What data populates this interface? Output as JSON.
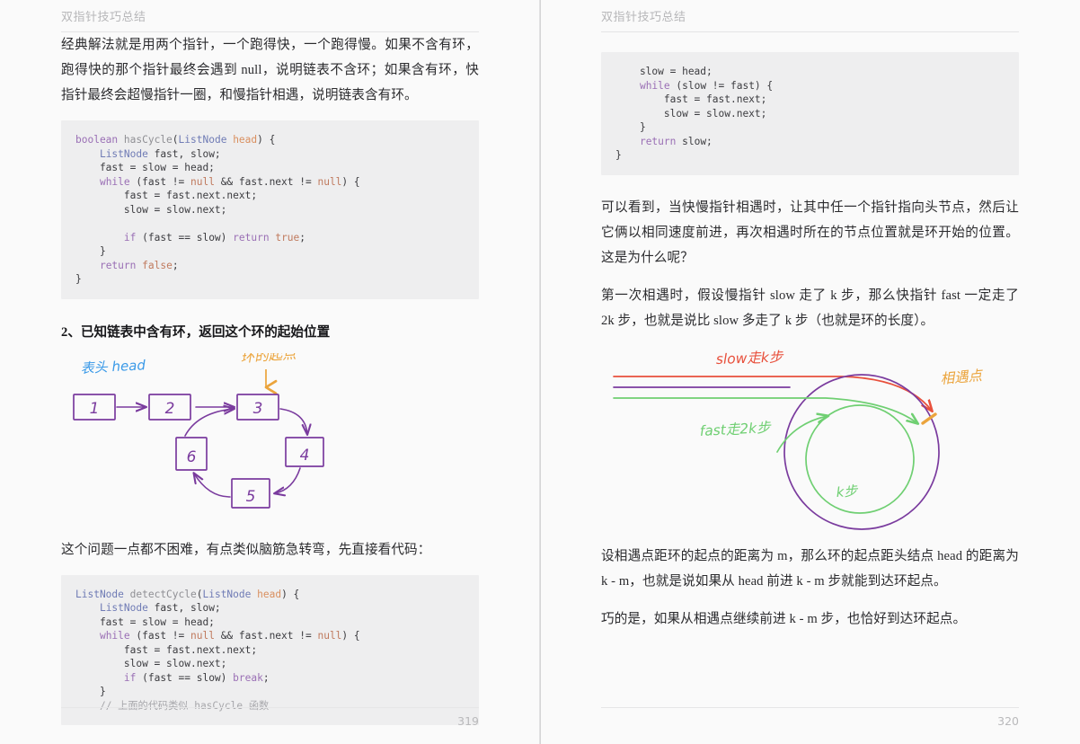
{
  "document": {
    "running_head": "双指针技巧总结",
    "colors": {
      "page_bg": "#fafafa",
      "code_bg": "#eeeeef",
      "ink_purple": "#7a3b9e",
      "ink_blue": "#3b9ae8",
      "ink_orange": "#eba43c",
      "ink_red": "#e8503c",
      "ink_green": "#6fcf72",
      "body_text": "#2b2b2e",
      "muted": "#b7b7b9"
    }
  },
  "left_page": {
    "page_number": "319",
    "paragraph_1": "经典解法就是用两个指针，一个跑得快，一个跑得慢。如果不含有环，跑得快的那个指针最终会遇到 null，说明链表不含环；如果含有环，快指针最终会超慢指针一圈，和慢指针相遇，说明链表含有环。",
    "code_1": {
      "language": "java",
      "lines": [
        "boolean hasCycle(ListNode head) {",
        "    ListNode fast, slow;",
        "    fast = slow = head;",
        "    while (fast != null && fast.next != null) {",
        "        fast = fast.next.next;",
        "        slow = slow.next;",
        "",
        "        if (fast == slow) return true;",
        "    }",
        "    return false;",
        "}"
      ]
    },
    "section_heading": "2、已知链表中含有环，返回这个环的起始位置",
    "figure": {
      "caption_head": "表头 head",
      "caption_cycle_start": "环的起点",
      "nodes": [
        "1",
        "2",
        "3",
        "4",
        "5",
        "6"
      ],
      "edges": "1→2→3→4→5→6→3"
    },
    "paragraph_2": "这个问题一点都不困难，有点类似脑筋急转弯，先直接看代码：",
    "code_2": {
      "language": "java",
      "lines": [
        "ListNode detectCycle(ListNode head) {",
        "    ListNode fast, slow;",
        "    fast = slow = head;",
        "    while (fast != null && fast.next != null) {",
        "        fast = fast.next.next;",
        "        slow = slow.next;",
        "        if (fast == slow) break;",
        "    }",
        "    // 上面的代码类似 hasCycle 函数"
      ]
    }
  },
  "right_page": {
    "page_number": "320",
    "code_1": {
      "language": "java",
      "lines": [
        "    slow = head;",
        "    while (slow != fast) {",
        "        fast = fast.next;",
        "        slow = slow.next;",
        "    }",
        "    return slow;",
        "}"
      ]
    },
    "paragraph_1": "可以看到，当快慢指针相遇时，让其中任一个指针指向头节点，然后让它俩以相同速度前进，再次相遇时所在的节点位置就是环开始的位置。这是为什么呢？",
    "paragraph_2": "第一次相遇时，假设慢指针 slow 走了 k 步，那么快指针 fast 一定走了 2k 步，也就是说比 slow 多走了 k 步（也就是环的长度）。",
    "figure": {
      "label_slow": "slow走k步",
      "label_fast": "fast走2k步",
      "label_meeting": "相遇点",
      "label_k": "k步"
    },
    "paragraph_3": "设相遇点距环的起点的距离为 m，那么环的起点距头结点 head 的距离为 k - m，也就是说如果从 head 前进 k - m 步就能到达环起点。",
    "paragraph_4": "巧的是，如果从相遇点继续前进 k - m 步，也恰好到达环起点。"
  }
}
